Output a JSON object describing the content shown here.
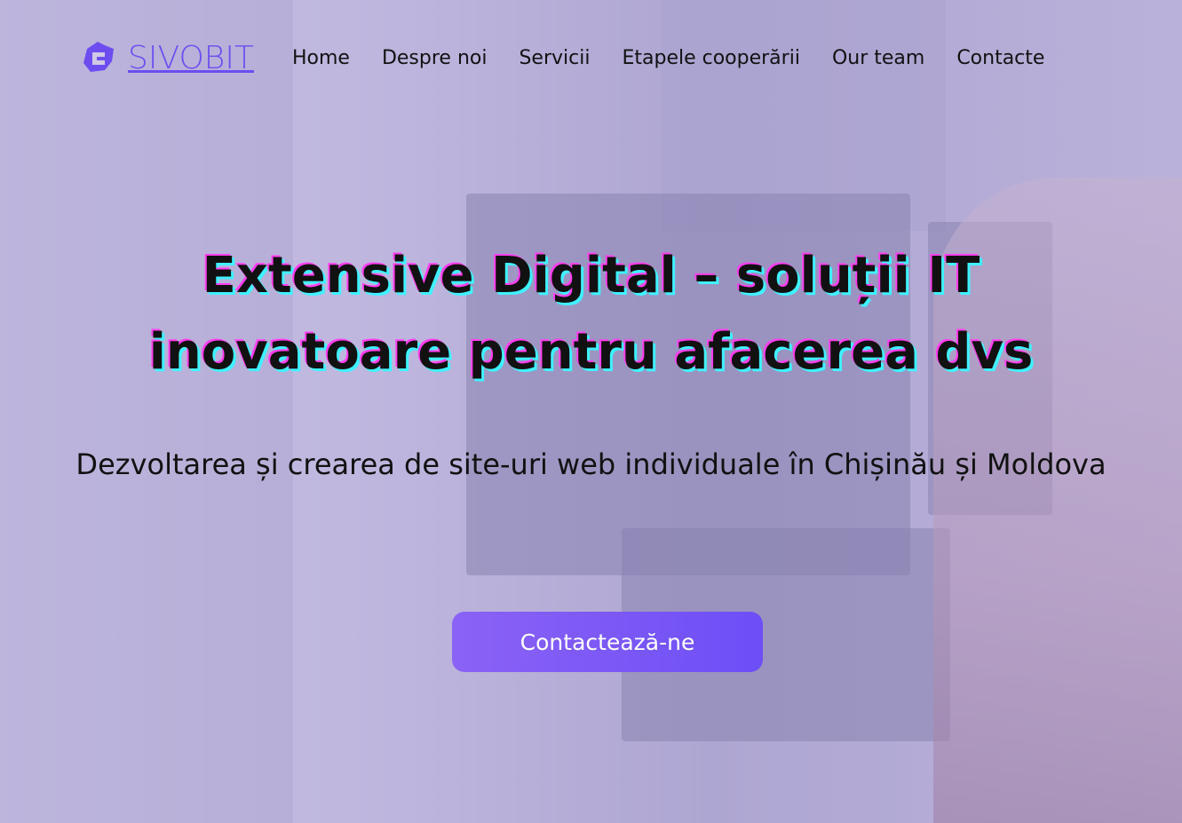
{
  "brand": {
    "name": "SIVOBIT",
    "accent": "#6d4df0"
  },
  "nav": {
    "items": [
      "Home",
      "Despre noi",
      "Servicii",
      "Etapele cooperării",
      "Our team",
      "Contacte"
    ]
  },
  "hero": {
    "title_line1": "Extensive Digital – soluții IT",
    "title_line2": "inovatoare pentru afacerea dvs",
    "subtitle": "Dezvoltarea și crearea de site-uri web individuale în Chișinău și Moldova",
    "cta_label": "Contactează-ne"
  }
}
